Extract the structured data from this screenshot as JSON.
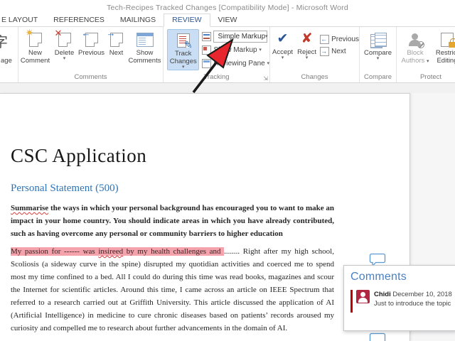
{
  "window": {
    "title": "Tech-Recipes Tracked Changes [Compatibility Mode] - Microsoft Word"
  },
  "tabs": [
    {
      "label": "E LAYOUT",
      "active": false
    },
    {
      "label": "REFERENCES",
      "active": false
    },
    {
      "label": "MAILINGS",
      "active": false
    },
    {
      "label": "REVIEW",
      "active": true
    },
    {
      "label": "VIEW",
      "active": false
    }
  ],
  "ribbon": {
    "language_partial": {
      "visible_label": "age",
      "icon_char": "字"
    },
    "comments": {
      "label": "Comments",
      "new_comment": "New Comment",
      "delete": "Delete",
      "previous": "Previous",
      "next": "Next",
      "show_comments": "Show Comments"
    },
    "tracking": {
      "label": "Tracking",
      "track_changes": "Track Changes",
      "markup_mode": "Simple Markup",
      "show_markup": "Show Markup",
      "reviewing_pane": "Reviewing Pane"
    },
    "changes": {
      "label": "Changes",
      "accept": "Accept",
      "reject": "Reject",
      "previous": "Previous",
      "next": "Next"
    },
    "compare": {
      "label": "Compare",
      "compare": "Compare"
    },
    "protect": {
      "label": "Protect",
      "block_authors_1": "Block",
      "block_authors_2": "Authors",
      "restrict_1": "Restrict",
      "restrict_2": "Editing"
    }
  },
  "icons": {
    "dropdown": "▾",
    "new_comment_star": "✷",
    "delete_x": "✕",
    "prev_arrow": "←",
    "next_arrow": "→",
    "accept_check": "✔",
    "reject_x": "✘",
    "pencil": "✎",
    "launcher": "⇲"
  },
  "doc": {
    "title": "CSC Application",
    "subtitle": "Personal Statement (500)",
    "p1_misspelled": "Summarise",
    "p1_rest": " the ways in which your personal background has encouraged you to want to make an impact in your home country. You should indicate areas in which you have already contributed, such as having overcome any personal or community barriers to higher education",
    "p2_hl_a": "My passion for ------ was ",
    "p2_hl_misspelled": "insireed",
    "p2_hl_b": " by my health challenges and ",
    "p2_rest": "........ Right after my high school, Scoliosis (a sideway curve in the spine) disrupted my quotidian activities and coerced me to spend most my time confined to a bed. All I could do during this time was read books, magazines and scour the Internet for scientific articles. Around this time, I came across an article on IEEE Spectrum that referred to a research carried out at Griffith University. This article discussed the application of AI (Artificial Intelligence) in medicine to cure chronic diseases based on patients’ records aroused my curiosity and compelled me to research about further advancements in the domain of AI."
  },
  "comments_pane": {
    "title": "Comments",
    "comment": {
      "author": "Chidi",
      "date": "December 10, 2018",
      "text": "Just to introduce the topic"
    }
  },
  "colors": {
    "accent_blue": "#2b579a",
    "heading_blue": "#2e74b5",
    "pane_title_blue": "#4a80c2",
    "highlight_pink": "#f4a2ab",
    "avatar_red": "#b12740",
    "comment_bar_red": "#c00000",
    "track_changes_active_bg": "#c9def4",
    "arrow_red": "#e8262d"
  }
}
